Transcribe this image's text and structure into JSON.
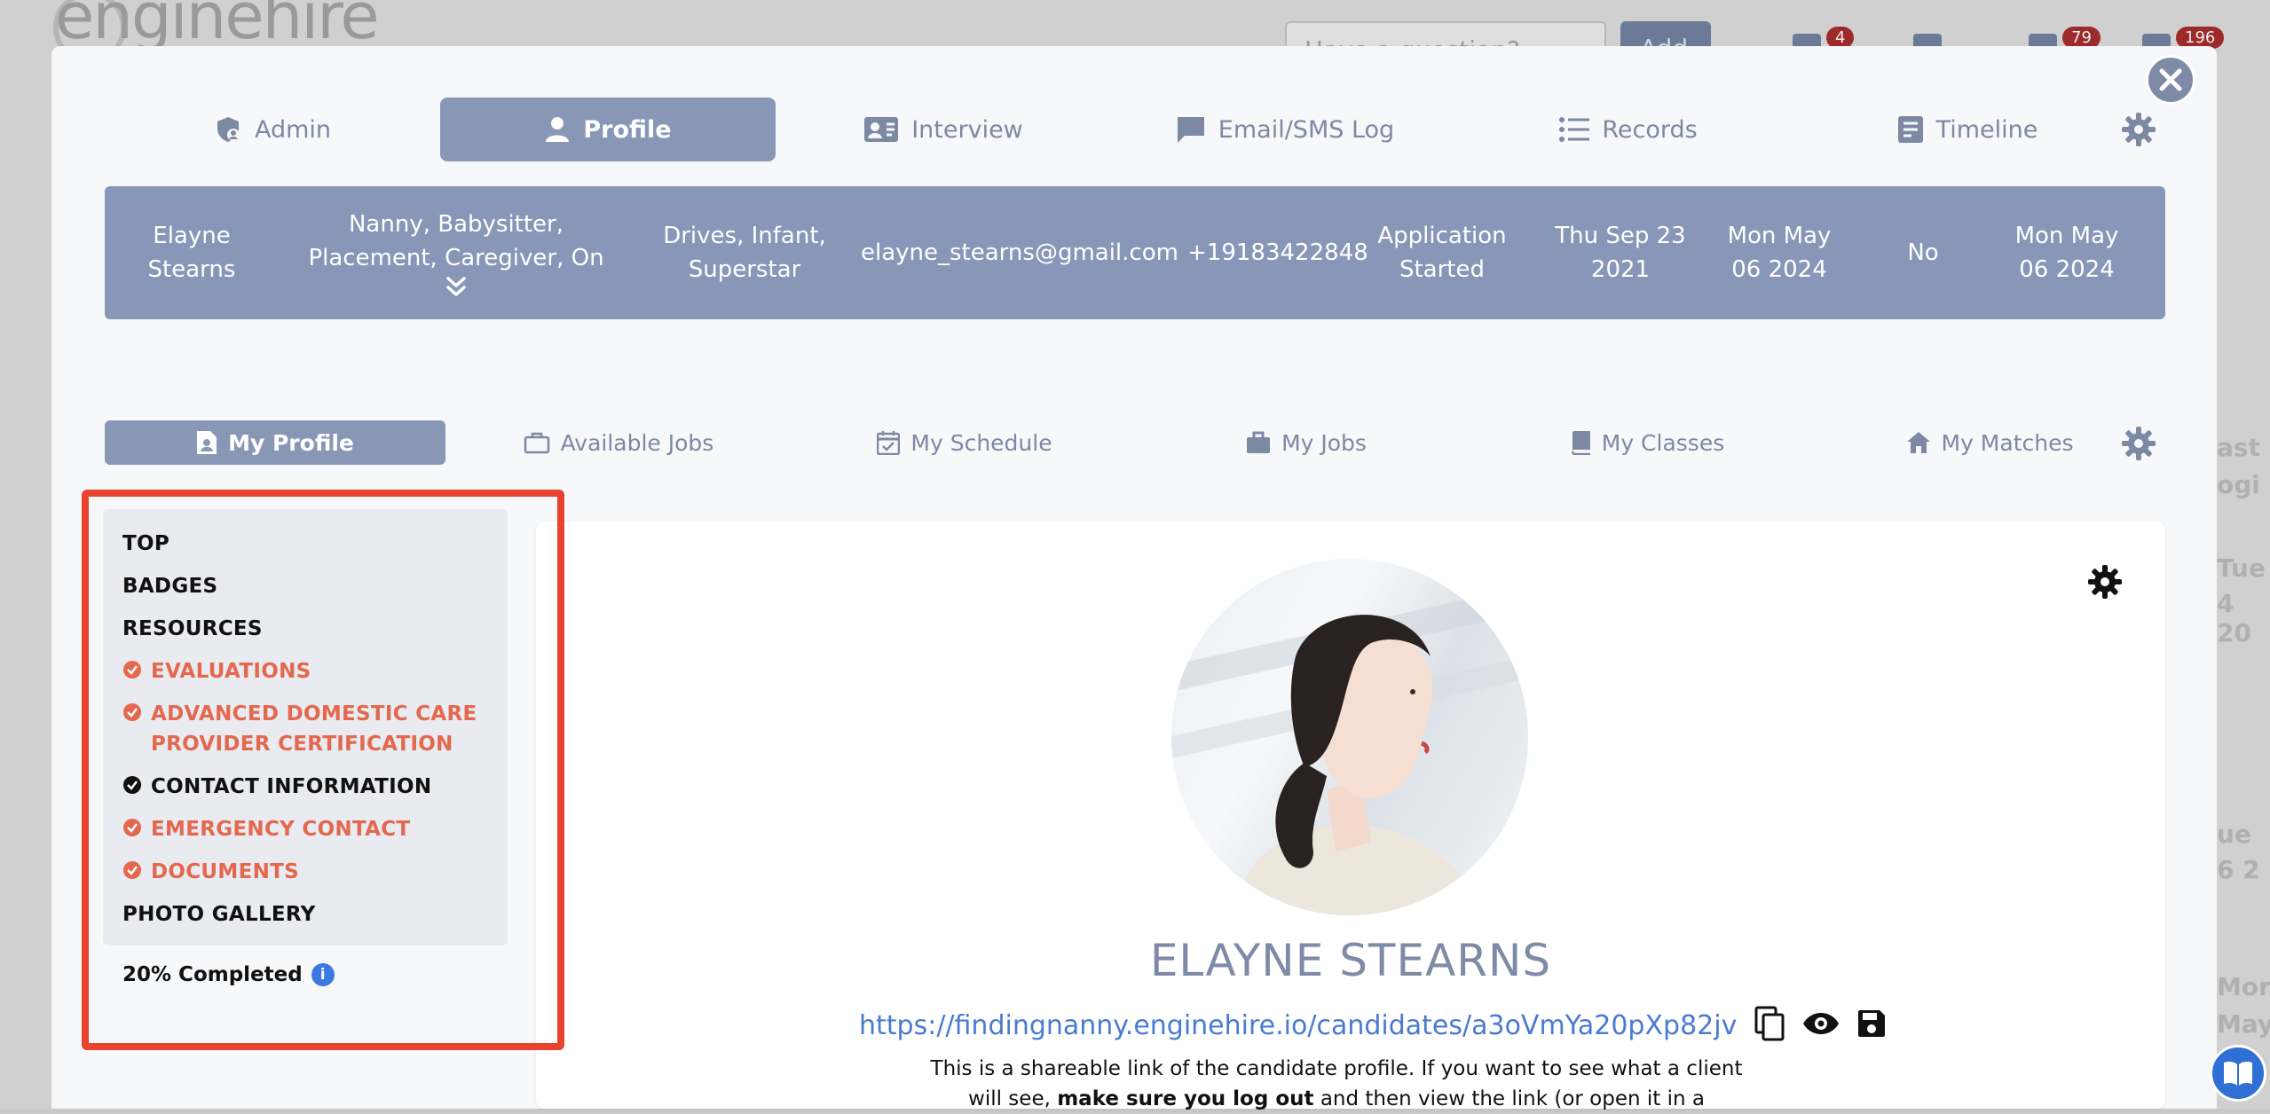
{
  "background": {
    "logo_text": "enginehire",
    "search_placeholder": "Have a question?",
    "add_label": "Add",
    "badges": [
      "4",
      "79",
      "196"
    ],
    "right_fragments": [
      "ast",
      "ogi",
      "Tue",
      "4 20",
      "ue",
      "6 2",
      "Mor",
      "May"
    ]
  },
  "top_tabs": [
    {
      "label": "Admin",
      "icon": "shield-user-icon",
      "active": false
    },
    {
      "label": "Profile",
      "icon": "person-icon",
      "active": true
    },
    {
      "label": "Interview",
      "icon": "contact-card-icon",
      "active": false
    },
    {
      "label": "Email/SMS Log",
      "icon": "chat-icon",
      "active": false
    },
    {
      "label": "Records",
      "icon": "list-icon",
      "active": false
    },
    {
      "label": "Timeline",
      "icon": "clipboard-icon",
      "active": false
    }
  ],
  "info_bar": {
    "name": "Elayne Stearns",
    "roles": "Nanny, Babysitter, Placement, Caregiver, On",
    "tags": "Drives, Infant, Superstar",
    "email": "elayne_stearns@gmail.com",
    "phone": "+19183422848",
    "status": "Application Started",
    "date1": "Thu Sep 23 2021",
    "date2": "Mon May 06 2024",
    "flag": "No",
    "date3": "Mon May 06 2024"
  },
  "sub_tabs": [
    {
      "label": "My Profile",
      "icon": "profile-doc-icon",
      "active": true
    },
    {
      "label": "Available Jobs",
      "icon": "briefcase-outline-icon",
      "active": false
    },
    {
      "label": "My Schedule",
      "icon": "calendar-check-icon",
      "active": false
    },
    {
      "label": "My Jobs",
      "icon": "briefcase-icon",
      "active": false
    },
    {
      "label": "My Classes",
      "icon": "book-icon",
      "active": false
    },
    {
      "label": "My Matches",
      "icon": "home-icon",
      "active": false
    }
  ],
  "nav": {
    "items": [
      {
        "label": "TOP",
        "status": "none"
      },
      {
        "label": "BADGES",
        "status": "none"
      },
      {
        "label": "RESOURCES",
        "status": "none"
      },
      {
        "label": "EVALUATIONS",
        "status": "done"
      },
      {
        "label": "ADVANCED DOMESTIC CARE PROVIDER CERTIFICATION",
        "status": "done"
      },
      {
        "label": "CONTACT INFORMATION",
        "status": "complete"
      },
      {
        "label": "EMERGENCY CONTACT",
        "status": "done"
      },
      {
        "label": "DOCUMENTS",
        "status": "done"
      },
      {
        "label": "PHOTO GALLERY",
        "status": "none"
      }
    ],
    "completed_label": "20% Completed",
    "completed_fraction": 0.2
  },
  "profile": {
    "name": "ELAYNE STEARNS",
    "share_link": "https://findingnanny.enginehire.io/candidates/a3oVmYa20pXp82jv",
    "share_text_1": "This is a shareable link of the candidate profile. If you want to see what a client will see, ",
    "share_text_bold": "make sure you log out",
    "share_text_2": " and then view the link (or open it in a"
  },
  "colors": {
    "accent": "#8896b7",
    "done": "#e3684e",
    "highlight": "#e8432e",
    "link": "#4a7bd0"
  }
}
